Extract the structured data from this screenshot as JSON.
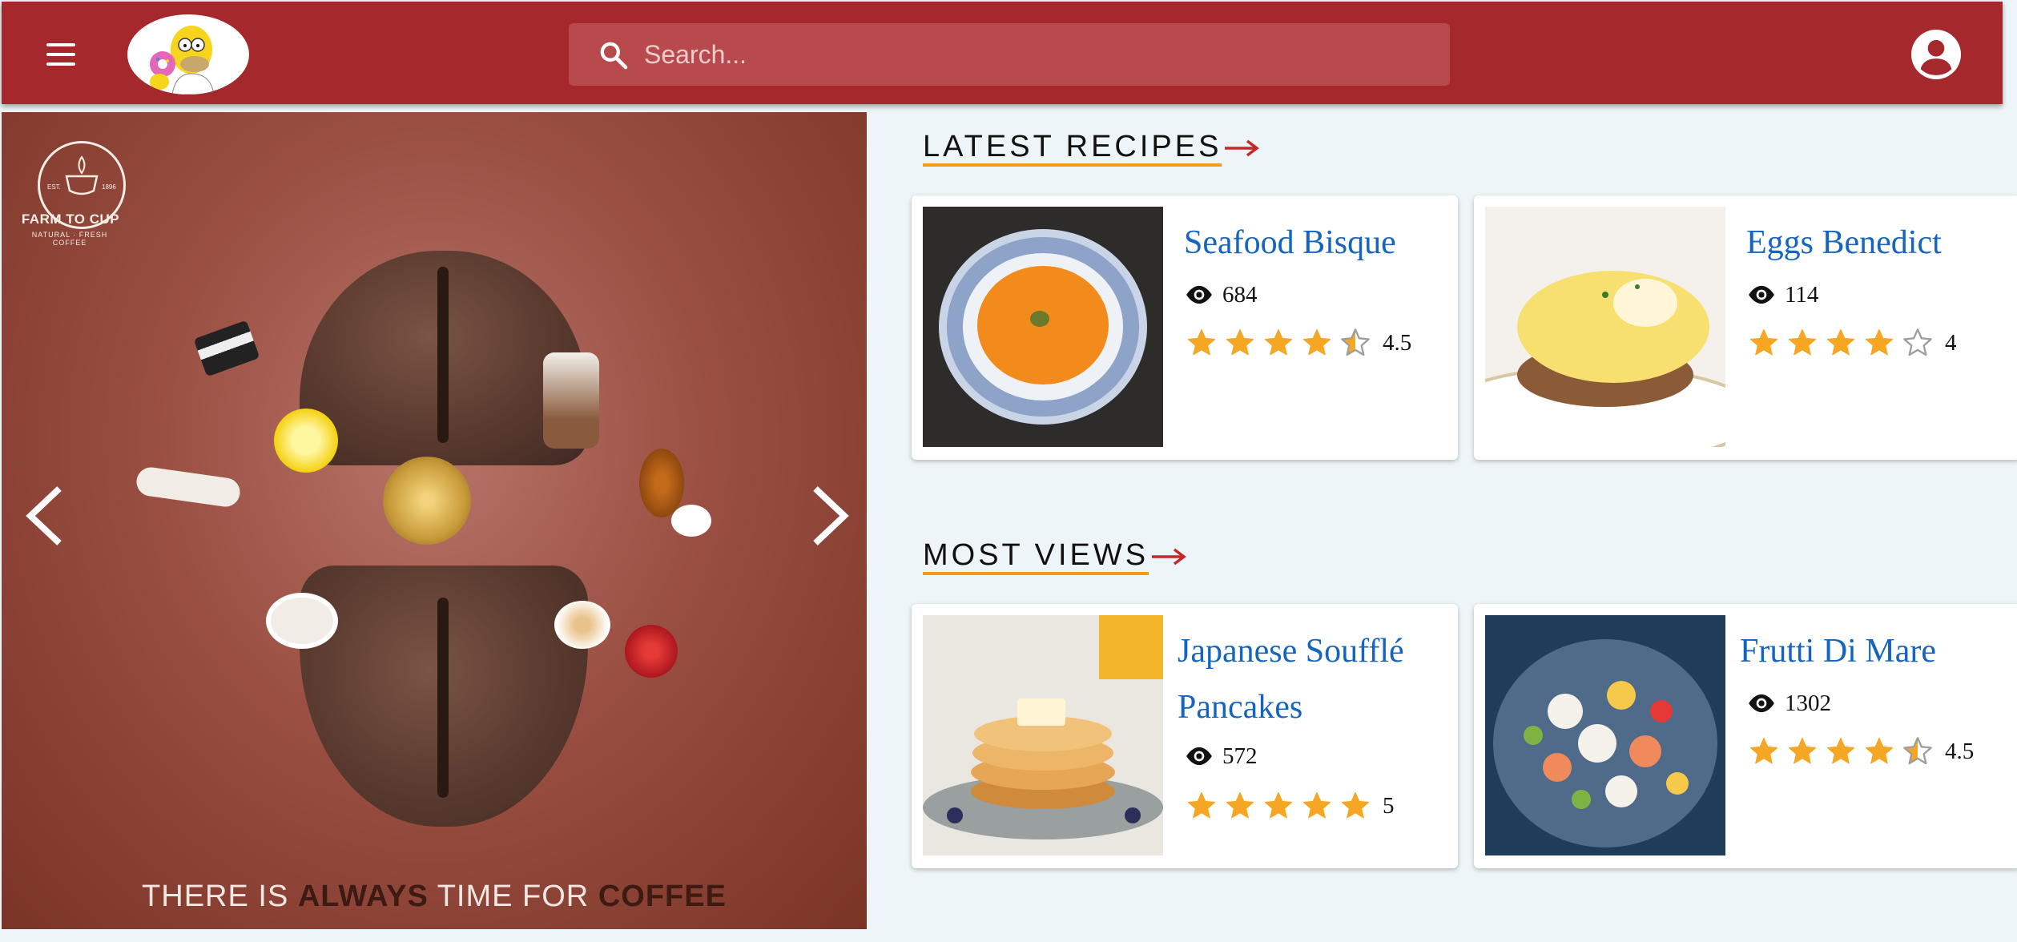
{
  "header": {
    "search_placeholder": "Search...",
    "icons": [
      "menu-icon",
      "search-icon",
      "account-circle-icon"
    ],
    "colors": {
      "appbar": "#a5282c",
      "search_bg": "#b84a4d"
    }
  },
  "carousel": {
    "brand_name": "FARM TO CUP",
    "brand_sub": "NATURAL · FRESH COFFEE",
    "brand_est": "EST.",
    "brand_year": "1896",
    "slogan_part1": "THERE IS ",
    "slogan_bold1": "ALWAYS",
    "slogan_part2": " TIME FOR ",
    "slogan_bold2": "COFFEE"
  },
  "latest": {
    "title": "LATEST RECIPES",
    "cards": [
      {
        "title": "Seafood Bisque",
        "views": "684",
        "rating": 4.5,
        "rating_text": "4.5"
      },
      {
        "title": "Eggs Benedict",
        "views": "114",
        "rating": 4,
        "rating_text": "4"
      }
    ]
  },
  "most_views": {
    "title": "MOST VIEWS",
    "cards": [
      {
        "title": "Japanese Soufflé Pancakes",
        "views": "572",
        "rating": 5,
        "rating_text": "5"
      },
      {
        "title": "Frutti Di Mare",
        "views": "1302",
        "rating": 4.5,
        "rating_text": "4.5"
      }
    ]
  },
  "colors": {
    "link": "#1565c0",
    "star": "#f5a623",
    "underline": "#f39c12",
    "arrow": "#c62828"
  }
}
